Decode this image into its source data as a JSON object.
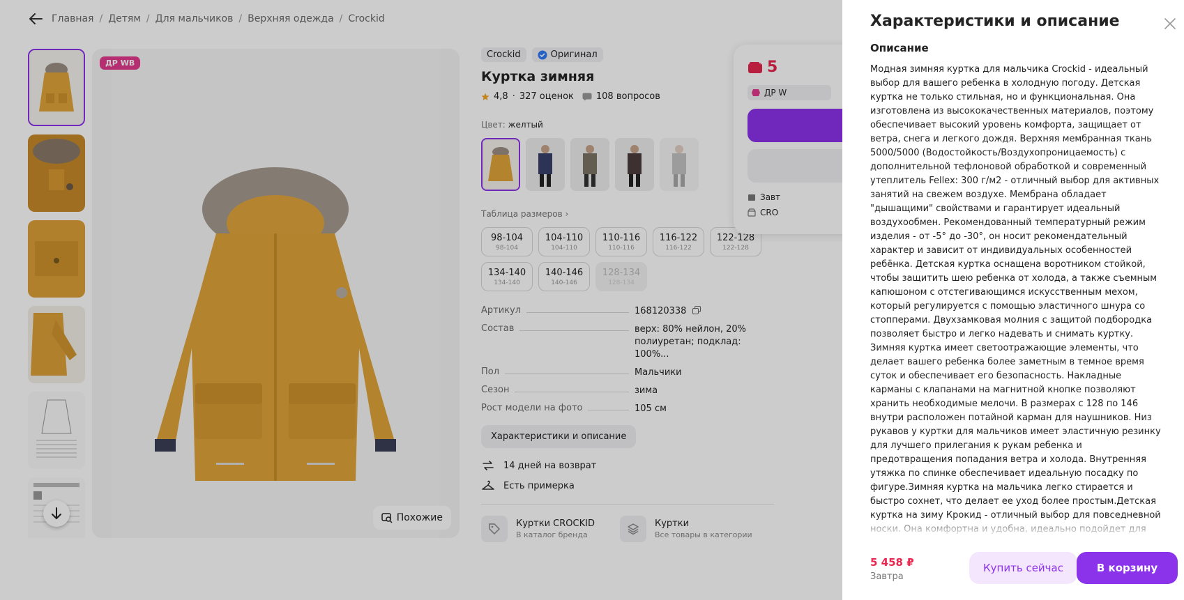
{
  "breadcrumbs": [
    "Главная",
    "Детям",
    "Для мальчиков",
    "Верхняя одежда",
    "Crockid"
  ],
  "gallery": {
    "badge": "ДР WB",
    "similar_label": "Похожие"
  },
  "product": {
    "brand": "Crockid",
    "original_label": "Оригинал",
    "title": "Куртка зимняя",
    "rating": "4,8",
    "reviews": "327 оценок",
    "questions": "108 вопросов",
    "color_label": "Цвет:",
    "color_value": "желтый",
    "size_table_label": "Таблица размеров",
    "sizes": [
      {
        "main": "98-104",
        "sub": "98-104",
        "available": true
      },
      {
        "main": "104-110",
        "sub": "104-110",
        "available": true
      },
      {
        "main": "110-116",
        "sub": "110-116",
        "available": true
      },
      {
        "main": "116-122",
        "sub": "116-122",
        "available": true
      },
      {
        "main": "122-128",
        "sub": "122-128",
        "available": true
      },
      {
        "main": "134-140",
        "sub": "134-140",
        "available": true
      },
      {
        "main": "140-146",
        "sub": "140-146",
        "available": true
      },
      {
        "main": "128-134",
        "sub": "128-134",
        "available": false
      }
    ],
    "params": [
      {
        "name": "Артикул",
        "value": "168120338"
      },
      {
        "name": "Состав",
        "value": "верх: 80% нейлон, 20% полиуретан; подклад: 100%..."
      },
      {
        "name": "Пол",
        "value": "Мальчики"
      },
      {
        "name": "Сезон",
        "value": "зима"
      },
      {
        "name": "Рост модели на фото",
        "value": "105 см"
      }
    ],
    "desc_button": "Характеристики и описание",
    "return_label": "14 дней на возврат",
    "fitting_label": "Есть примерка",
    "brand_link": {
      "title": "Куртки CROCKID",
      "sub": "В каталог бренда"
    },
    "category_link": {
      "title": "Куртки",
      "sub": "Все товары в категории"
    }
  },
  "buy_card": {
    "price_partial": "5",
    "dr_partial": "ДР W",
    "line1": "Завт",
    "line2": "CRO"
  },
  "panel": {
    "title": "Характеристики и описание",
    "section": "Описание",
    "description": "Модная зимняя куртка для мальчика Crockid - идеальный выбор для вашего ребенка в холодную погоду. Детская куртка не только стильная, но и функциональная. Она изготовлена из высококачественных материалов, поэтому обеспечивает высокий уровень комфорта, защищает от ветра, снега и легкого дождя. Верхняя мембранная ткань 5000/5000 (Водостойкость/Воздухопроницаемость) с дополнительной тефлоновой обработкой и современный утеплитель Fellex: 300 г/м2 - отличный выбор для активных занятий на свежем воздухе. Мембрана обладает \"дышащими\" свойствами и гарантирует идеальный воздухообмен. Рекомендованный температурный режим изделия - от -5° до -30°, он носит рекомендательный характер и зависит от индивидуальных особенностей ребёнка. Детская куртка оснащена воротником стойкой, чтобы защитить шею ребенка от холода, а также съемным капюшоном с отстегивающимся искусственным мехом, который регулируется с помощью эластичного шнура со стопперами. Двухзамковая молния с защитой подбородка позволяет быстро и легко надевать и снимать куртку. Зимняя куртка имеет светоотражающие элементы, что делает вашего ребенка более заметным в темное время суток и обеспечивает его безопасность. Накладные карманы с клапанами на магнитной кнопке позволяют хранить необходимые мелочи. В размерах с 128 по 146 внутри расположен потайной карман для наушников. Низ рукавов у куртки для мальчиков имеет эластичную резинку для лучшего прилегания к рукам ребенка и предотвращения попадания ветра и холода. Внутренняя утяжка по спинке обеспечивает идеальную посадку по фигуре.Зимняя куртка на мальчика легко стирается и быстро сохнет, что делает ее уход более простым.Детская куртка на зиму Крокид - отличный выбор для повседневной носки. Она комфортна и удобна, идеально подойдет для школы, детского сада, прогулок с друзьями и других ежедневных мероприятий. Трендовая зимняя куртка для мальчика - это отличный выбор для тех, кто ищет",
    "price": "5 458 ₽",
    "delivery": "Завтра",
    "buy_now": "Купить сейчас",
    "add_to_cart": "В корзину"
  },
  "colors": {
    "accent": "#8b33ea",
    "price": "#e8264e",
    "jacket": "#e0a43a"
  }
}
